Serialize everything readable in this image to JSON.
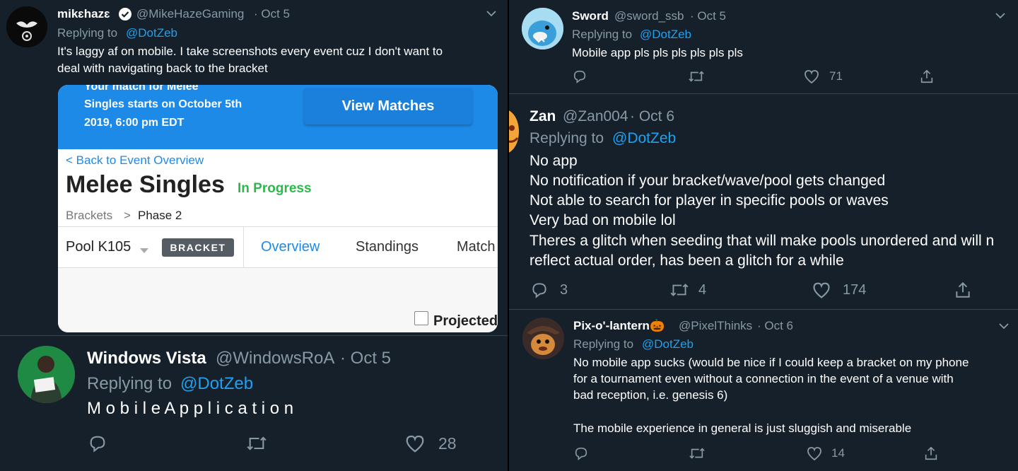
{
  "tweets": {
    "mike": {
      "name": "mikɛhazɛ",
      "handle": "@MikeHazeGaming",
      "date": "· Oct 5",
      "replying": "Replying to",
      "replying_to": "@DotZeb",
      "text1": "It's laggy af on mobile. I take screenshots every event cuz I don't want to",
      "text2": "deal with navigating back to the bracket",
      "verified": true,
      "icon": "chevron-down-icon"
    },
    "card": {
      "banner1": "Your match for Melee",
      "banner2": "Singles starts on October 5th",
      "banner3": "2019, 6:00 pm EDT",
      "view_matches": "View Matches",
      "back": "< Back to Event Overview",
      "title": "Melee Singles",
      "status": "In Progress",
      "crumb_root": "Brackets",
      "crumb_sep": ">",
      "crumb_leaf": "Phase 2",
      "pool": "Pool K105",
      "bracket_badge": "BRACKET",
      "tab_overview": "Overview",
      "tab_standings": "Standings",
      "tab_match": "Match",
      "projected": "Projected"
    },
    "vista": {
      "name": "Windows Vista",
      "handle": "@WindowsRoA",
      "date": "· Oct 5",
      "replying": "Replying to",
      "replying_to": "@DotZeb",
      "text": "M o b i l e A p p l i c a t i o n",
      "likes": "28"
    },
    "sword": {
      "name": "Sword",
      "handle": "@sword_ssb",
      "date": "· Oct 5",
      "replying": "Replying to",
      "replying_to": "@DotZeb",
      "text": "Mobile app pls pls pls pls pls pls",
      "likes": "71"
    },
    "zan": {
      "name": "Zan",
      "handle": "@Zan004",
      "date": "· Oct 6",
      "replying": "Replying to",
      "replying_to": "@DotZeb",
      "lines": [
        "No app",
        "No notification if your bracket/wave/pool gets changed",
        "Not able to search for player in specific pools or waves",
        "Very bad on mobile lol",
        "Theres a glitch when seeding that will make pools unordered and will n",
        "reflect actual order, has been a glitch for a while"
      ],
      "replies": "3",
      "retweets": "4",
      "likes": "174"
    },
    "pix": {
      "name": "Pix-o'-lantern🎃",
      "handle": "@PixelThinks",
      "date": "· Oct 6",
      "replying": "Replying to",
      "replying_to": "@DotZeb",
      "lines": [
        "No mobile app sucks (would be nice if I could keep a bracket on my phone",
        "for a tournament even without a connection in the event of a venue with",
        "bad reception, i.e. genesis 6)",
        "",
        "The mobile experience in general is just sluggish and miserable"
      ],
      "likes": "14"
    }
  },
  "colors": {
    "background": "#15202b",
    "link": "#1da1f2",
    "muted": "#8899a6",
    "banner": "#1e8ae8",
    "progress": "#2db84e"
  }
}
